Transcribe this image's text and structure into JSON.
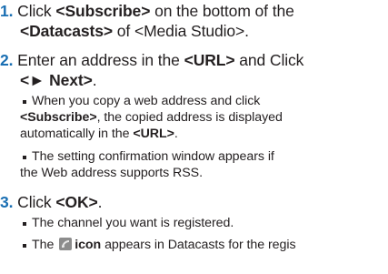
{
  "steps": [
    {
      "number": "1.",
      "lines": [
        {
          "prefix": "Click ",
          "bold": "<Subscribe>",
          "suffix": " on the bottom of the"
        },
        {
          "bold": "<Datacasts>",
          "suffix": " of <Media Studio>."
        }
      ],
      "bullets": []
    },
    {
      "number": "2.",
      "lines": [
        {
          "prefix": "Enter an address in the ",
          "bold": "<URL>",
          "suffix": " and Click"
        },
        {
          "bold": "<► Next>",
          "suffix": "."
        }
      ],
      "bullets": [
        {
          "lines": [
            {
              "text": "When you copy a web address and click"
            },
            {
              "bold": "<Subscribe>",
              "suffix": ", the copied address is displayed"
            },
            {
              "prefix": "automatically in the ",
              "bold": "<URL>",
              "suffix": "."
            }
          ]
        },
        {
          "lines": [
            {
              "text": "The setting confirmation window appears if"
            },
            {
              "text": "the Web address supports RSS."
            }
          ]
        }
      ]
    },
    {
      "number": "3.",
      "lines": [
        {
          "prefix": "Click ",
          "bold": "<OK>",
          "suffix": "."
        }
      ],
      "bullets": [
        {
          "lines": [
            {
              "text": "The channel you want is registered."
            }
          ]
        },
        {
          "lines": [
            {
              "prefix": "The ",
              "icon": "datacast-feed-icon",
              "bold": "icon",
              "suffix": " appears in Datacasts for the regis"
            }
          ]
        }
      ]
    }
  ]
}
